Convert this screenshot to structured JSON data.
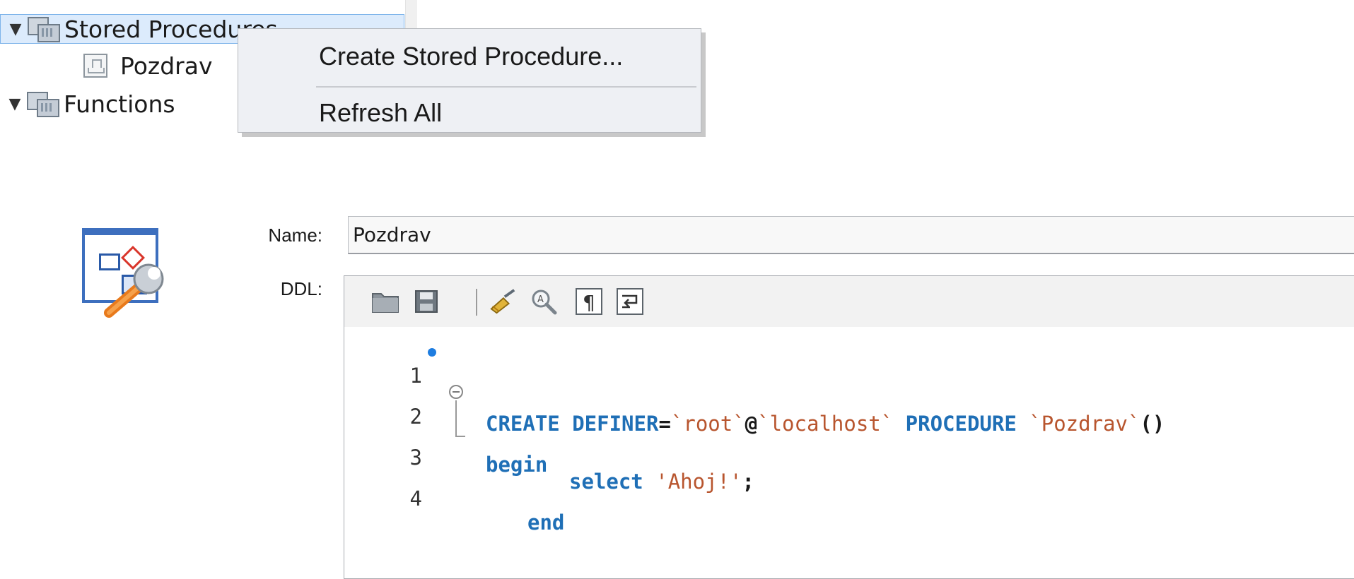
{
  "tree": {
    "items": [
      {
        "label": "Stored Procedures",
        "expander": "▼",
        "icon": "folder-icon",
        "selected": true
      },
      {
        "label": "Pozdrav",
        "icon": "procedure-icon"
      },
      {
        "label": "Functions",
        "expander": "▼",
        "icon": "folder-icon"
      }
    ]
  },
  "context_menu": {
    "items": [
      {
        "label": "Create Stored Procedure..."
      },
      {
        "label": "Refresh All"
      }
    ]
  },
  "editor": {
    "name_label": "Name:",
    "name_value": "Pozdrav",
    "ddl_label": "DDL:",
    "toolbar": [
      {
        "icon": "open-folder-icon"
      },
      {
        "icon": "save-icon"
      },
      {
        "icon": "beautify-brush-icon"
      },
      {
        "icon": "find-icon"
      },
      {
        "icon": "pilcrow-icon"
      },
      {
        "icon": "word-wrap-icon"
      }
    ],
    "code_lines": [
      {
        "number": "1",
        "k1": "CREATE DEFINER",
        "p1": "=",
        "s1": "`root`",
        "p2": "@",
        "s2": "`localhost`",
        "p3": " ",
        "k2": "PROCEDURE",
        "p4": " ",
        "s3": "`Pozdrav`",
        "p5": "()"
      },
      {
        "number": "2",
        "k1": "begin"
      },
      {
        "number": "3",
        "k1": "select",
        "p1": " ",
        "s1": "'Ahoj!'",
        "p2": ";"
      },
      {
        "number": "4",
        "k1": "end"
      }
    ]
  },
  "colors": {
    "keyword": "#1f6fb6",
    "string": "#b8552e",
    "selection": "#dcebfc"
  }
}
